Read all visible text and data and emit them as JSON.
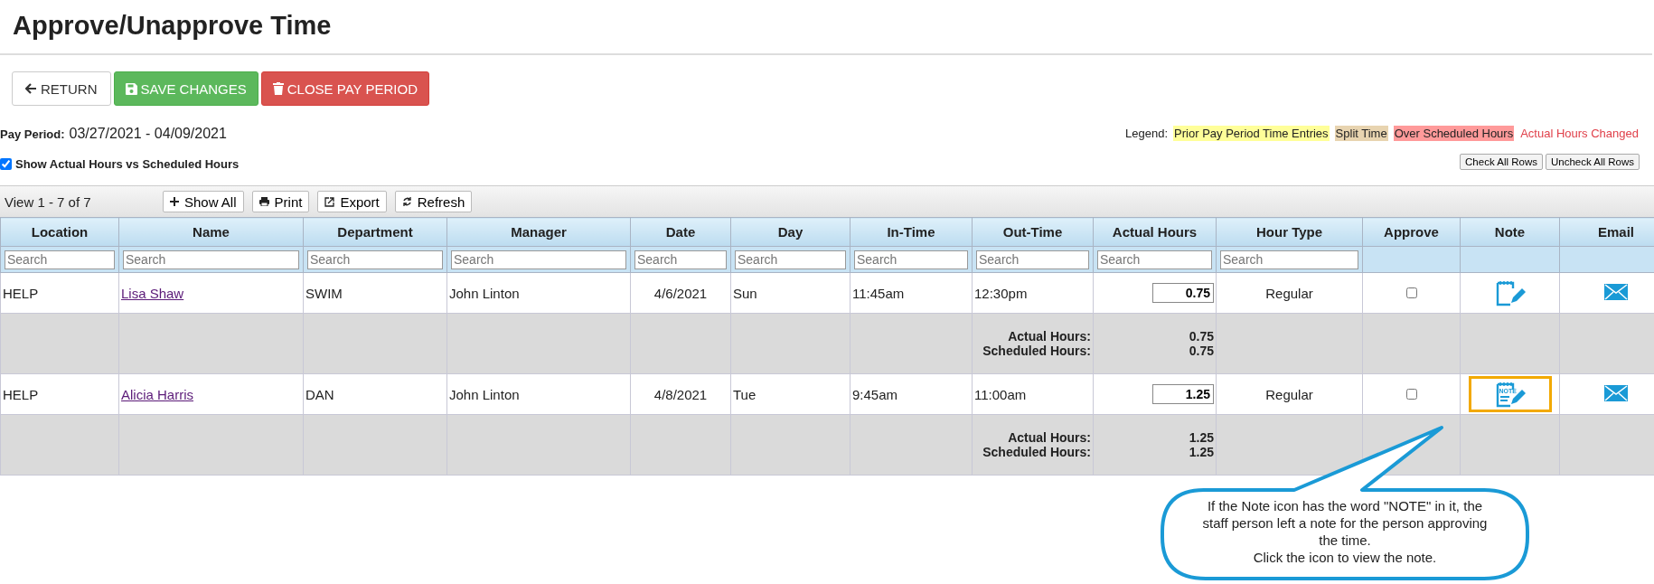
{
  "page_title": "Approve/Unapprove Time",
  "buttons": [
    {
      "label": "RETURN",
      "kind": "return"
    },
    {
      "label": "SAVE CHANGES",
      "kind": "save"
    },
    {
      "label": "CLOSE PAY PERIOD",
      "kind": "close"
    }
  ],
  "pay_period": {
    "label": "Pay Period:",
    "value": "03/27/2021 - 04/09/2021"
  },
  "show_actual": {
    "label": "Show Actual Hours vs Scheduled Hours",
    "checked": true
  },
  "legend": {
    "label": "Legend:",
    "items": [
      {
        "label": "Prior Pay Period Time Entries",
        "kind": "highlight",
        "color": "#ffff99"
      },
      {
        "label": "Split Time",
        "kind": "highlight",
        "color": "#e8d4b0"
      },
      {
        "label": "Over Scheduled Hours",
        "kind": "highlight",
        "color": "#ff9a9a"
      },
      {
        "label": "Actual Hours Changed",
        "kind": "text",
        "color": "#e0404a"
      }
    ]
  },
  "row_buttons": [
    "Check All Rows",
    "Uncheck All Rows"
  ],
  "toolbar": {
    "view": "View 1 - 7 of 7",
    "buttons": [
      {
        "label": "Show All",
        "kind": "show_all"
      },
      {
        "label": "Print",
        "kind": "print"
      },
      {
        "label": "Export",
        "kind": "export"
      },
      {
        "label": "Refresh",
        "kind": "refresh"
      }
    ]
  },
  "table": {
    "columns": [
      {
        "label": "Location",
        "placeholder": "Search"
      },
      {
        "label": "Name",
        "placeholder": "Search"
      },
      {
        "label": "Department",
        "placeholder": "Search"
      },
      {
        "label": "Manager",
        "placeholder": "Search"
      },
      {
        "label": "Date",
        "placeholder": "Search"
      },
      {
        "label": "Day",
        "placeholder": "Search"
      },
      {
        "label": "In-Time",
        "placeholder": "Search"
      },
      {
        "label": "Out-Time",
        "placeholder": "Search"
      },
      {
        "label": "Actual Hours",
        "placeholder": "Search"
      },
      {
        "label": "Hour Type",
        "placeholder": "Search"
      },
      {
        "label": "Approve"
      },
      {
        "label": "Note"
      },
      {
        "label": "Email"
      }
    ],
    "rows": [
      {
        "location": "HELP",
        "name": "Lisa Shaw",
        "department": "SWIM",
        "manager": "John Linton",
        "date": "4/6/2021",
        "day": "Sun",
        "in_time": "11:45am",
        "out_time": "12:30pm",
        "actual_hours": "0.75",
        "hour_type": "Regular",
        "approve": false,
        "highlighted": false,
        "summary": {
          "actual_label": "Actual Hours:",
          "actual": "0.75",
          "scheduled_label": "Scheduled Hours:",
          "scheduled": "0.75"
        }
      },
      {
        "location": "HELP",
        "name": "Alicia Harris",
        "department": "DAN",
        "manager": "John Linton",
        "date": "4/8/2021",
        "day": "Tue",
        "in_time": "9:45am",
        "out_time": "11:00am",
        "actual_hours": "1.25",
        "hour_type": "Regular",
        "approve": false,
        "note_label": "NOTE",
        "highlighted": true,
        "summary": {
          "actual_label": "Actual Hours:",
          "actual": "1.25",
          "scheduled_label": "Scheduled Hours:",
          "scheduled": "1.25"
        }
      }
    ]
  },
  "callout": "If the Note icon has the word \"NOTE\" in it, the staff person left a note for the person approving the time.\nClick the icon to view the note."
}
